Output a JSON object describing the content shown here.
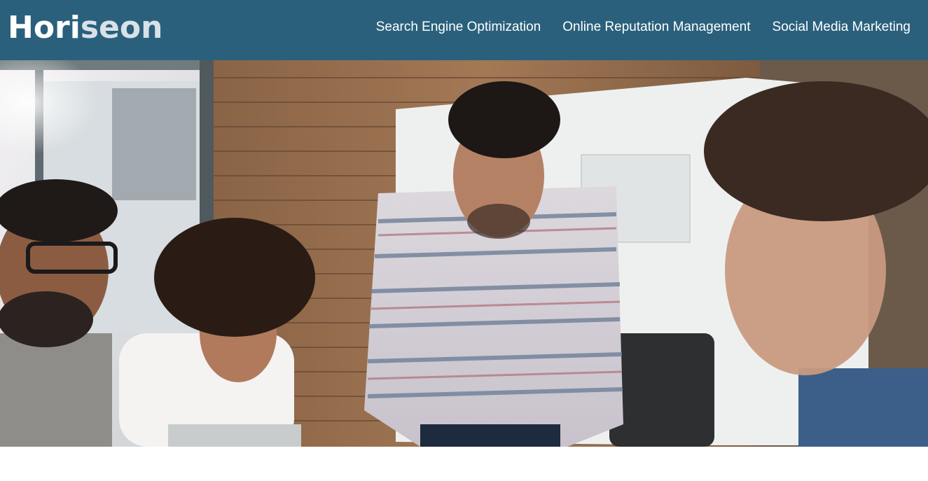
{
  "header": {
    "logo_part1": "Hori",
    "logo_part2": "seon",
    "nav": [
      {
        "label": "Search Engine Optimization"
      },
      {
        "label": "Online Reputation Management"
      },
      {
        "label": "Social Media Marketing"
      }
    ]
  },
  "hero": {
    "image_icon": "team-meeting-photo"
  },
  "colors": {
    "header_bg": "#2a607c",
    "logo_text": "#ffffff",
    "logo_accent": "#d9e1e8",
    "nav_text": "#ffffff"
  }
}
